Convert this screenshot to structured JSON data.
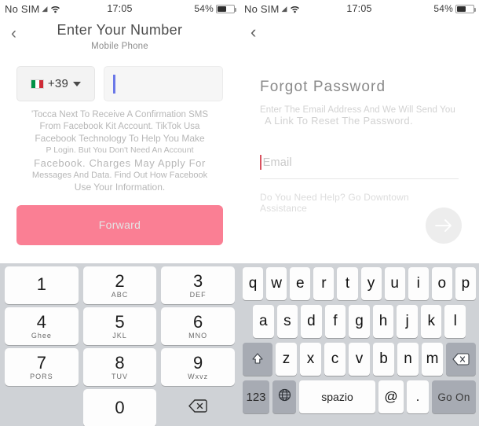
{
  "left": {
    "status": {
      "carrier": "No SIM",
      "signal_icon": "signal-icon",
      "wifi_icon": "wifi-icon",
      "time": "17:05",
      "battery_text": "54%",
      "battery_icon": "battery-icon"
    },
    "header": {
      "back_icon": "chevron-left-icon",
      "title": "Enter Your Number",
      "subtitle": "Mobile Phone"
    },
    "phone_input": {
      "flag_icon": "italy-flag-icon",
      "country_code": "+39",
      "caret_icon": "chevron-down-icon",
      "value": "",
      "placeholder": ""
    },
    "disclaimer": [
      "'Tocca Next To Receive A Confirmation SMS",
      "From Facebook Kit Account. TikTok Usa",
      "Facebook Technology To Help You Make",
      "P Login. But You Don't Need An Account",
      "Facebook. Charges May Apply For",
      "Messages And Data. Find Out How Facebook",
      "Use Your Information."
    ],
    "forward_button": "Forward"
  },
  "right": {
    "status": {
      "carrier": "No SIM",
      "signal_icon": "signal-icon",
      "wifi_icon": "wifi-icon",
      "time": "17:05",
      "battery_text": "54%",
      "battery_icon": "battery-icon"
    },
    "header": {
      "back_icon": "chevron-left-icon"
    },
    "title": "Forgot Password",
    "subtitle_line1": "Enter The Email Address And We Will Send You",
    "subtitle_line2": "A Link To Reset The Password.",
    "email": {
      "placeholder": "Email",
      "value": ""
    },
    "help_line1": "Do You Need Help? Go Downtown",
    "help_line2": "Assistance",
    "fab_icon": "arrow-right-icon"
  },
  "numeric_keyboard": {
    "rows": [
      [
        {
          "digit": "1",
          "letters": ""
        },
        {
          "digit": "2",
          "letters": "ABC"
        },
        {
          "digit": "3",
          "letters": "DEF"
        }
      ],
      [
        {
          "digit": "4",
          "letters": "Ghee"
        },
        {
          "digit": "5",
          "letters": "JKL"
        },
        {
          "digit": "6",
          "letters": "MNO"
        }
      ],
      [
        {
          "digit": "7",
          "letters": "PORS"
        },
        {
          "digit": "8",
          "letters": "TUV"
        },
        {
          "digit": "9",
          "letters": "Wxvz"
        }
      ]
    ],
    "zero": {
      "digit": "0",
      "letters": ""
    },
    "delete_icon": "backspace-icon"
  },
  "qwerty_keyboard": {
    "row1": [
      "q",
      "w",
      "e",
      "r",
      "t",
      "y",
      "u",
      "i",
      "o",
      "p"
    ],
    "row2": [
      "a",
      "s",
      "d",
      "f",
      "g",
      "h",
      "j",
      "k",
      "l"
    ],
    "row3": [
      "z",
      "x",
      "c",
      "v",
      "b",
      "n",
      "m"
    ],
    "shift_icon": "shift-icon",
    "delete_icon": "backspace-icon",
    "numbers_key": "123",
    "globe_icon": "globe-icon",
    "space_key": "spazio",
    "at_key": "@",
    "dot_key": ".",
    "go_key": "Go On"
  },
  "colors": {
    "accent_pink": "#fa7f94",
    "keyboard_bg": "#cfd2d6",
    "mod_key": "#a7abb3"
  }
}
